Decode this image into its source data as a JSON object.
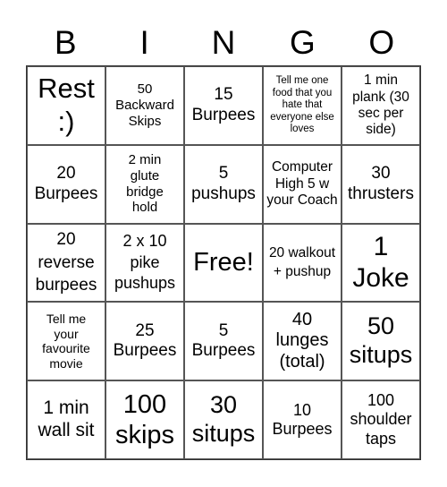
{
  "header": [
    "B",
    "I",
    "N",
    "G",
    "O"
  ],
  "cells": [
    "Rest :)",
    "50 Backward Skips",
    "15 Burpees",
    "Tell me one food that you hate that everyone else loves",
    "1 min plank (30 sec per side)",
    "20 Burpees",
    "2 min glute bridge hold",
    "5 pushups",
    "Computer High 5 w your Coach",
    "30 thrusters",
    "20 reverse burpees",
    "2 x 10 pike pushups",
    "Free!",
    "20 walkout + pushup",
    "1 Joke",
    "Tell me your favourite movie",
    "25 Burpees",
    "5 Burpees",
    "40 lunges (total)",
    "50 situps",
    "1 min wall sit",
    "100 skips",
    "30 situps",
    "10 Burpees",
    "100 shoulder taps"
  ]
}
